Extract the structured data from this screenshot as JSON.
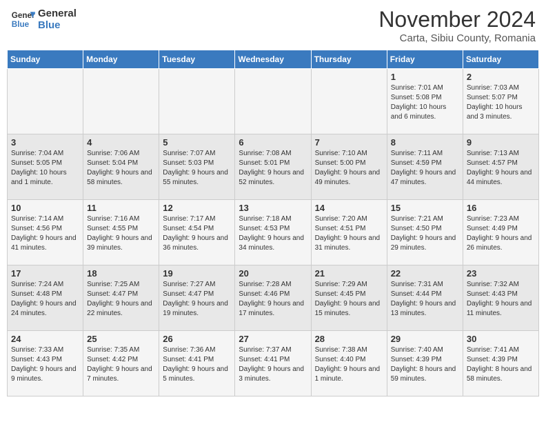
{
  "logo": {
    "line1": "General",
    "line2": "Blue"
  },
  "title": "November 2024",
  "subtitle": "Carta, Sibiu County, Romania",
  "days_header": [
    "Sunday",
    "Monday",
    "Tuesday",
    "Wednesday",
    "Thursday",
    "Friday",
    "Saturday"
  ],
  "weeks": [
    [
      {
        "day": "",
        "info": ""
      },
      {
        "day": "",
        "info": ""
      },
      {
        "day": "",
        "info": ""
      },
      {
        "day": "",
        "info": ""
      },
      {
        "day": "",
        "info": ""
      },
      {
        "day": "1",
        "info": "Sunrise: 7:01 AM\nSunset: 5:08 PM\nDaylight: 10 hours and 6 minutes."
      },
      {
        "day": "2",
        "info": "Sunrise: 7:03 AM\nSunset: 5:07 PM\nDaylight: 10 hours and 3 minutes."
      }
    ],
    [
      {
        "day": "3",
        "info": "Sunrise: 7:04 AM\nSunset: 5:05 PM\nDaylight: 10 hours and 1 minute."
      },
      {
        "day": "4",
        "info": "Sunrise: 7:06 AM\nSunset: 5:04 PM\nDaylight: 9 hours and 58 minutes."
      },
      {
        "day": "5",
        "info": "Sunrise: 7:07 AM\nSunset: 5:03 PM\nDaylight: 9 hours and 55 minutes."
      },
      {
        "day": "6",
        "info": "Sunrise: 7:08 AM\nSunset: 5:01 PM\nDaylight: 9 hours and 52 minutes."
      },
      {
        "day": "7",
        "info": "Sunrise: 7:10 AM\nSunset: 5:00 PM\nDaylight: 9 hours and 49 minutes."
      },
      {
        "day": "8",
        "info": "Sunrise: 7:11 AM\nSunset: 4:59 PM\nDaylight: 9 hours and 47 minutes."
      },
      {
        "day": "9",
        "info": "Sunrise: 7:13 AM\nSunset: 4:57 PM\nDaylight: 9 hours and 44 minutes."
      }
    ],
    [
      {
        "day": "10",
        "info": "Sunrise: 7:14 AM\nSunset: 4:56 PM\nDaylight: 9 hours and 41 minutes."
      },
      {
        "day": "11",
        "info": "Sunrise: 7:16 AM\nSunset: 4:55 PM\nDaylight: 9 hours and 39 minutes."
      },
      {
        "day": "12",
        "info": "Sunrise: 7:17 AM\nSunset: 4:54 PM\nDaylight: 9 hours and 36 minutes."
      },
      {
        "day": "13",
        "info": "Sunrise: 7:18 AM\nSunset: 4:53 PM\nDaylight: 9 hours and 34 minutes."
      },
      {
        "day": "14",
        "info": "Sunrise: 7:20 AM\nSunset: 4:51 PM\nDaylight: 9 hours and 31 minutes."
      },
      {
        "day": "15",
        "info": "Sunrise: 7:21 AM\nSunset: 4:50 PM\nDaylight: 9 hours and 29 minutes."
      },
      {
        "day": "16",
        "info": "Sunrise: 7:23 AM\nSunset: 4:49 PM\nDaylight: 9 hours and 26 minutes."
      }
    ],
    [
      {
        "day": "17",
        "info": "Sunrise: 7:24 AM\nSunset: 4:48 PM\nDaylight: 9 hours and 24 minutes."
      },
      {
        "day": "18",
        "info": "Sunrise: 7:25 AM\nSunset: 4:47 PM\nDaylight: 9 hours and 22 minutes."
      },
      {
        "day": "19",
        "info": "Sunrise: 7:27 AM\nSunset: 4:47 PM\nDaylight: 9 hours and 19 minutes."
      },
      {
        "day": "20",
        "info": "Sunrise: 7:28 AM\nSunset: 4:46 PM\nDaylight: 9 hours and 17 minutes."
      },
      {
        "day": "21",
        "info": "Sunrise: 7:29 AM\nSunset: 4:45 PM\nDaylight: 9 hours and 15 minutes."
      },
      {
        "day": "22",
        "info": "Sunrise: 7:31 AM\nSunset: 4:44 PM\nDaylight: 9 hours and 13 minutes."
      },
      {
        "day": "23",
        "info": "Sunrise: 7:32 AM\nSunset: 4:43 PM\nDaylight: 9 hours and 11 minutes."
      }
    ],
    [
      {
        "day": "24",
        "info": "Sunrise: 7:33 AM\nSunset: 4:43 PM\nDaylight: 9 hours and 9 minutes."
      },
      {
        "day": "25",
        "info": "Sunrise: 7:35 AM\nSunset: 4:42 PM\nDaylight: 9 hours and 7 minutes."
      },
      {
        "day": "26",
        "info": "Sunrise: 7:36 AM\nSunset: 4:41 PM\nDaylight: 9 hours and 5 minutes."
      },
      {
        "day": "27",
        "info": "Sunrise: 7:37 AM\nSunset: 4:41 PM\nDaylight: 9 hours and 3 minutes."
      },
      {
        "day": "28",
        "info": "Sunrise: 7:38 AM\nSunset: 4:40 PM\nDaylight: 9 hours and 1 minute."
      },
      {
        "day": "29",
        "info": "Sunrise: 7:40 AM\nSunset: 4:39 PM\nDaylight: 8 hours and 59 minutes."
      },
      {
        "day": "30",
        "info": "Sunrise: 7:41 AM\nSunset: 4:39 PM\nDaylight: 8 hours and 58 minutes."
      }
    ]
  ]
}
